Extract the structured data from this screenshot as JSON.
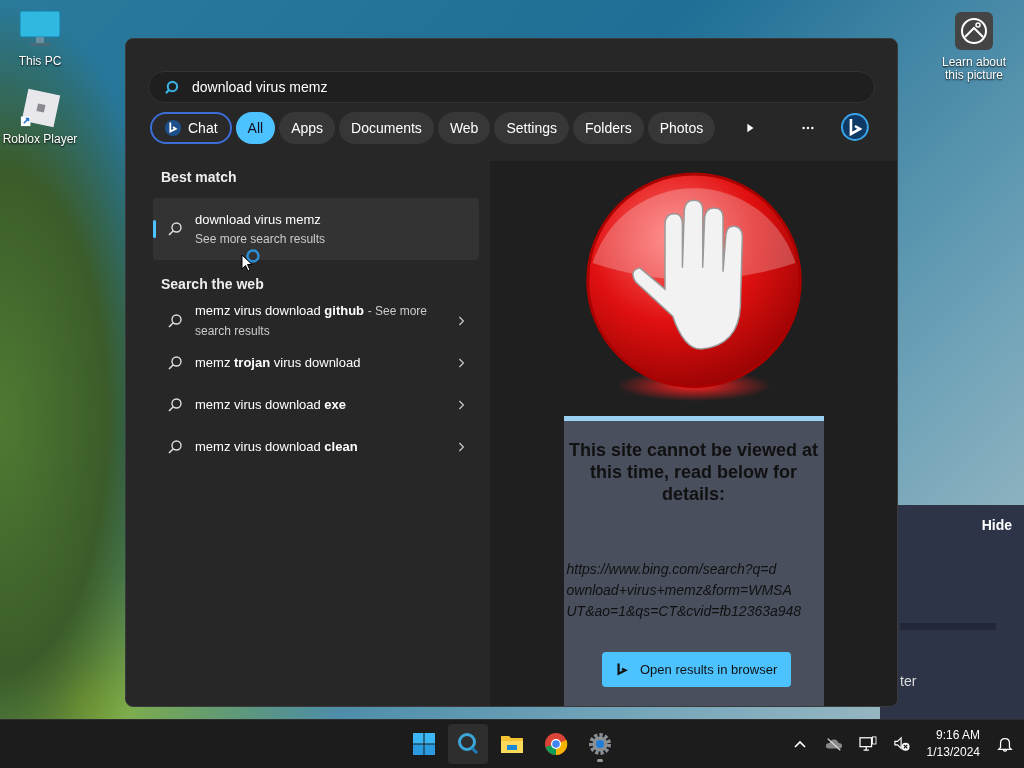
{
  "desktop_icons": [
    {
      "kind": "pc",
      "label": "This PC"
    },
    {
      "kind": "roblox",
      "label": "Roblox Player"
    }
  ],
  "spotlight": {
    "label": "Learn about this picture"
  },
  "search": {
    "value": "download virus memz"
  },
  "filters": [
    {
      "kind": "chat",
      "label": "Chat",
      "selected": false
    },
    {
      "kind": "pill",
      "label": "All",
      "selected": true
    },
    {
      "kind": "pill",
      "label": "Apps",
      "selected": false
    },
    {
      "kind": "pill",
      "label": "Documents",
      "selected": false
    },
    {
      "kind": "pill",
      "label": "Web",
      "selected": false
    },
    {
      "kind": "pill",
      "label": "Settings",
      "selected": false
    },
    {
      "kind": "pill",
      "label": "Folders",
      "selected": false
    },
    {
      "kind": "pill",
      "label": "Photos",
      "selected": false
    }
  ],
  "best_match": {
    "heading": "Best match",
    "title": "download virus memz",
    "subtitle": "See more search results",
    "selected": true
  },
  "web": {
    "heading": "Search the web",
    "items": [
      {
        "text": "memz virus download **github**",
        "suffix": "- See more search results"
      },
      {
        "text": "memz **trojan** virus download"
      },
      {
        "text": "memz virus download **exe**"
      },
      {
        "text": "memz virus download **clean**"
      }
    ]
  },
  "preview": {
    "heading": "This site cannot be viewed at this time, read below for details:",
    "url_lines": [
      "https://www.bing.com/search?q=d",
      "ownload+virus+memz&form=WMSA",
      "UT&ao=1&qs=CT&cvid=fb12363a948"
    ],
    "button": "Open results in browser"
  },
  "background_panel": {
    "button": "Hide",
    "text": "ter"
  },
  "taskbar": {
    "apps": [
      {
        "kind": "start",
        "active": false,
        "running": false
      },
      {
        "kind": "search",
        "active": true,
        "running": false
      },
      {
        "kind": "folder",
        "active": false,
        "running": false
      },
      {
        "kind": "chrome",
        "active": false,
        "running": false
      },
      {
        "kind": "gear",
        "active": false,
        "running": true
      }
    ],
    "time": "9:16 AM",
    "date": "1/13/2024"
  }
}
